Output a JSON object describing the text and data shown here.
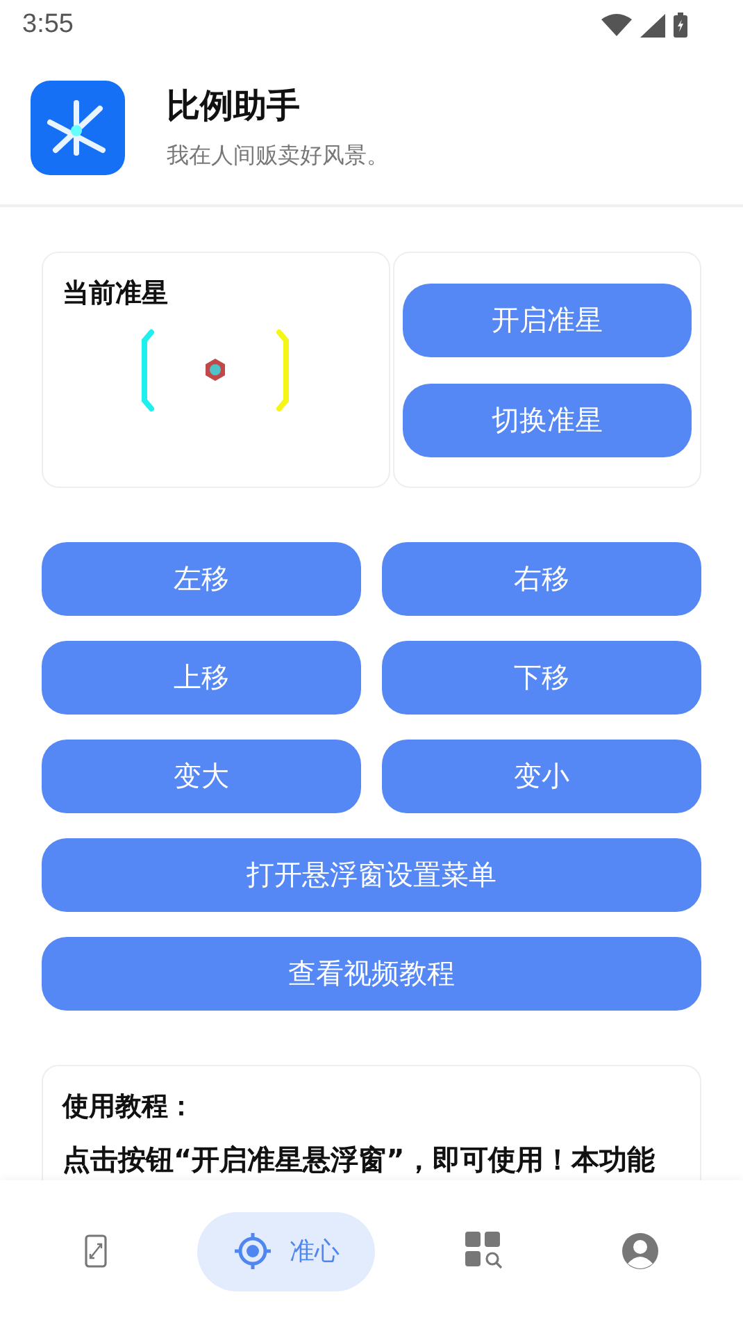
{
  "status_bar": {
    "time": "3:55"
  },
  "header": {
    "title": "比例助手",
    "subtitle": "我在人间贩卖好风景。"
  },
  "crosshair_card": {
    "title": "当前准星"
  },
  "crosshair_actions": [
    "开启准星",
    "切换准星"
  ],
  "controls": [
    {
      "label": "左移",
      "kind": "half"
    },
    {
      "label": "右移",
      "kind": "half"
    },
    {
      "label": "上移",
      "kind": "half"
    },
    {
      "label": "下移",
      "kind": "half"
    },
    {
      "label": "变大",
      "kind": "half"
    },
    {
      "label": "变小",
      "kind": "half"
    },
    {
      "label": "打开悬浮窗设置菜单",
      "kind": "full"
    },
    {
      "label": "查看视频教程",
      "kind": "full"
    }
  ],
  "tutorial": {
    "title": "使用教程：",
    "text": "点击按钮“开启准星悬浮窗”，即可使用！本功能"
  },
  "bottom_nav": [
    {
      "kind": "phone",
      "selected": false
    },
    {
      "kind": "crosshair",
      "label": "准心",
      "selected": true
    },
    {
      "kind": "apps",
      "selected": false
    },
    {
      "kind": "profile",
      "selected": false
    }
  ]
}
